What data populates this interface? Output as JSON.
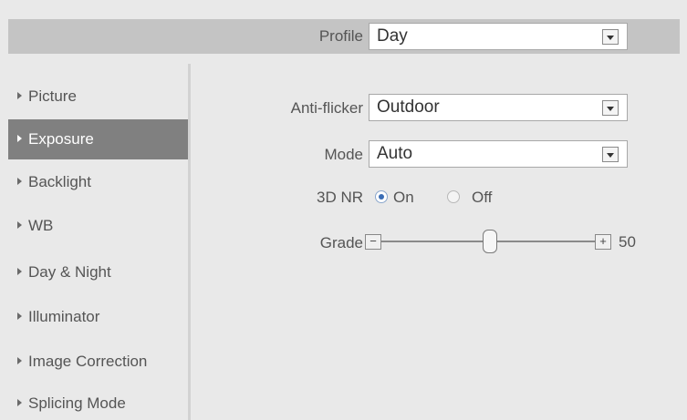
{
  "profile": {
    "label": "Profile",
    "value": "Day"
  },
  "sidebar": {
    "items": [
      {
        "label": "Picture"
      },
      {
        "label": "Exposure"
      },
      {
        "label": "Backlight"
      },
      {
        "label": "WB"
      },
      {
        "label": "Day & Night"
      },
      {
        "label": "Illuminator"
      },
      {
        "label": "Image Correction"
      },
      {
        "label": "Splicing Mode"
      }
    ],
    "active": "Exposure"
  },
  "form": {
    "anti_flicker": {
      "label": "Anti-flicker",
      "value": "Outdoor"
    },
    "mode": {
      "label": "Mode",
      "value": "Auto"
    },
    "nr3d": {
      "label": "3D NR",
      "options": [
        "On",
        "Off"
      ],
      "selected": "On"
    },
    "grade": {
      "label": "Grade",
      "value": "50",
      "minus": "−",
      "plus": "+",
      "min": 0,
      "max": 100
    }
  }
}
